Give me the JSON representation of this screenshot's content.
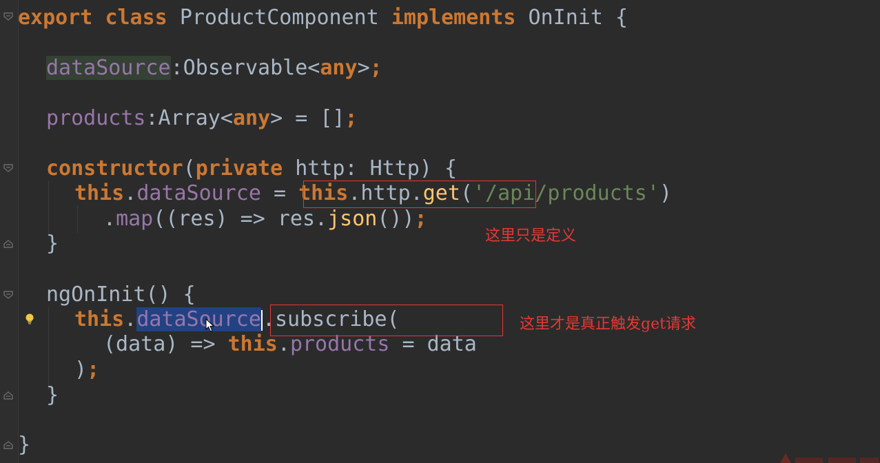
{
  "code": {
    "l1": [
      "export",
      "class",
      "ProductComponent",
      "implements",
      "OnInit",
      "{"
    ],
    "l2": [
      "dataSource",
      ":Observable<",
      "any",
      ">",
      ";"
    ],
    "l3": [
      "products",
      ":Array<",
      "any",
      "> = []",
      ";"
    ],
    "l4": [
      "constructor",
      "(",
      "private",
      " http: Http) {"
    ],
    "l5": [
      "this",
      ".",
      "dataSource",
      " = ",
      "this",
      ".http.",
      "get",
      "(",
      "'/api/products'",
      ")"
    ],
    "l6": [
      ".",
      "map",
      "((res) => res.",
      "json",
      "())",
      ";"
    ],
    "l7": "}",
    "l8": [
      "ngOnInit",
      "() {"
    ],
    "l9": [
      "this",
      ".",
      "dataSource",
      ".subscribe("
    ],
    "l10": [
      "(data) => ",
      "this",
      ".",
      "products",
      " = data"
    ],
    "l11": [
      ")",
      ";"
    ],
    "l12": "}",
    "l13": "}"
  },
  "annotations": {
    "definition_note": "这里只是定义",
    "trigger_note": "这里才是真正触发get请求"
  },
  "colors": {
    "background": "#2b2b2b",
    "keyword": "#cc7832",
    "property": "#9876aa",
    "string": "#6a8759",
    "function": "#ffc66d",
    "text": "#a9b7c6",
    "selection": "#214283",
    "annotation": "#e53935"
  },
  "icons": {
    "fold": "fold-marker-icon",
    "intention": "lightbulb-icon",
    "pointer": "mouse-pointer-icon"
  }
}
